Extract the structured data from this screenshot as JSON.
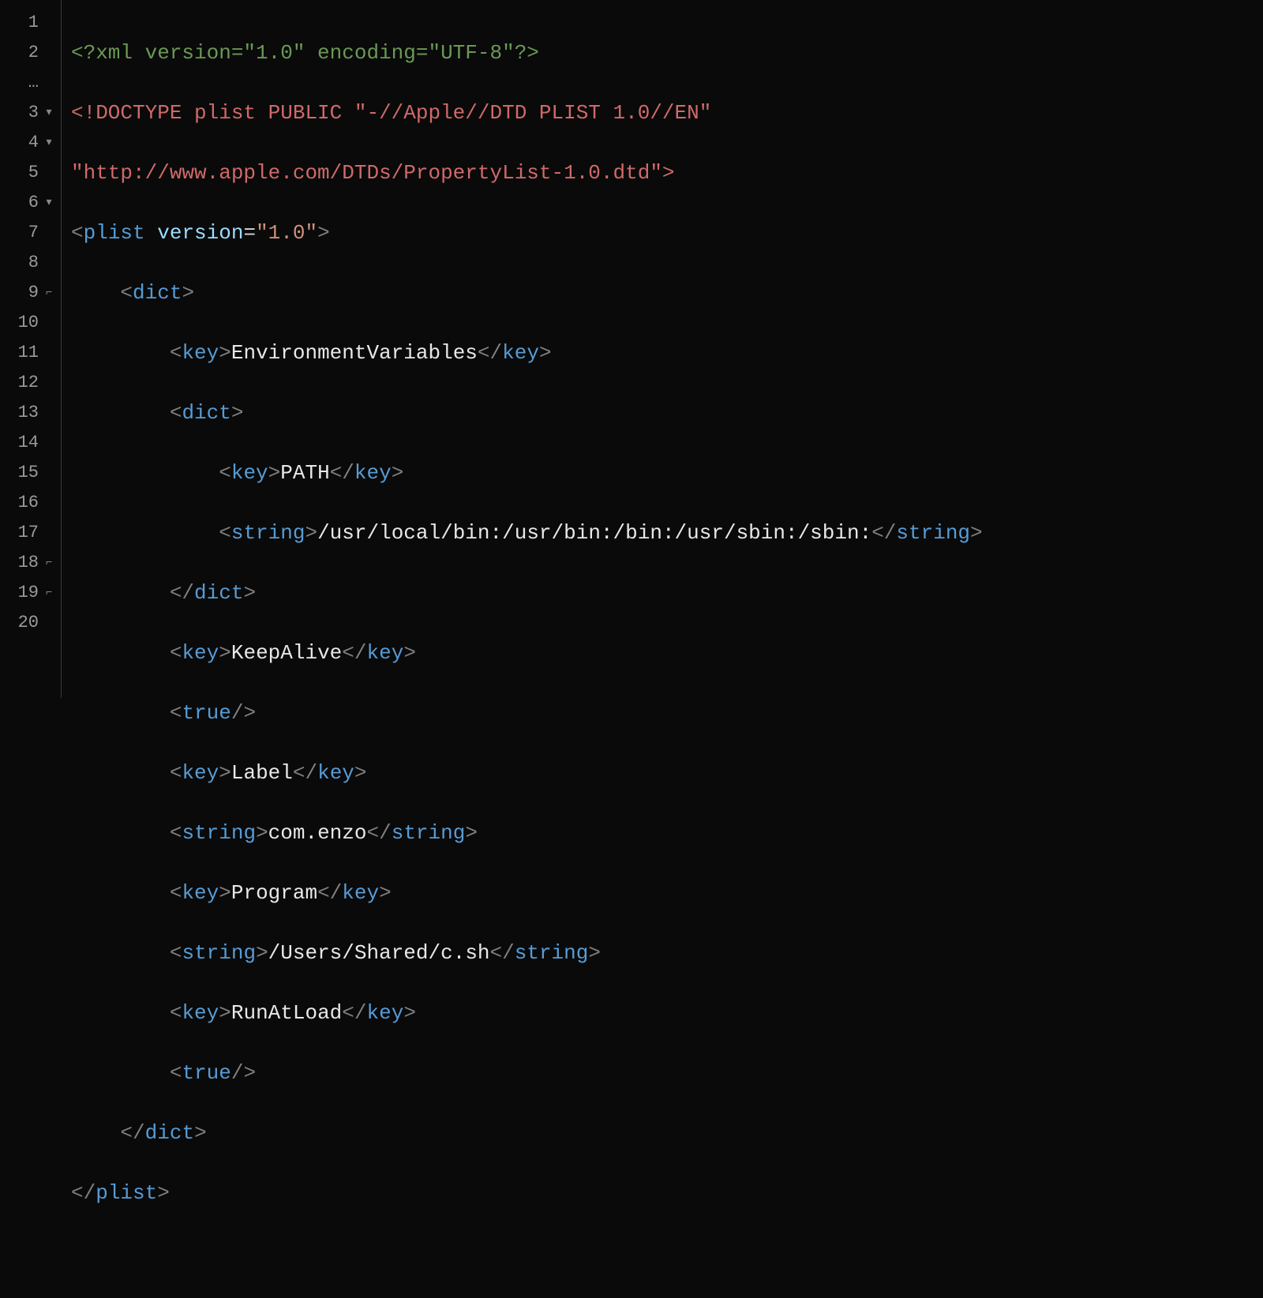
{
  "gutter": [
    {
      "n": "1",
      "fold": ""
    },
    {
      "n": "2",
      "fold": ""
    },
    {
      "n": "…",
      "fold": ""
    },
    {
      "n": "3",
      "fold": "▾"
    },
    {
      "n": "4",
      "fold": "▾"
    },
    {
      "n": "5",
      "fold": ""
    },
    {
      "n": "6",
      "fold": "▾"
    },
    {
      "n": "7",
      "fold": ""
    },
    {
      "n": "8",
      "fold": ""
    },
    {
      "n": "9",
      "fold": "⌐"
    },
    {
      "n": "10",
      "fold": ""
    },
    {
      "n": "11",
      "fold": ""
    },
    {
      "n": "12",
      "fold": ""
    },
    {
      "n": "13",
      "fold": ""
    },
    {
      "n": "14",
      "fold": ""
    },
    {
      "n": "15",
      "fold": ""
    },
    {
      "n": "16",
      "fold": ""
    },
    {
      "n": "17",
      "fold": ""
    },
    {
      "n": "18",
      "fold": "⌐"
    },
    {
      "n": "19",
      "fold": "⌐"
    },
    {
      "n": "20",
      "fold": ""
    }
  ],
  "code": {
    "l1": {
      "decl": "<?xml version=\"1.0\" encoding=\"UTF-8\"?>"
    },
    "l2": {
      "a": "<!DOCTYPE plist PUBLIC \"-//Apple//DTD PLIST 1.0//EN\""
    },
    "l2b": {
      "a": "\"http://www.apple.com/DTDs/PropertyList-1.0.dtd\">"
    },
    "l3": {
      "tag": "plist",
      "attr": "version",
      "val": "\"1.0\""
    },
    "l4": {
      "tag": "dict"
    },
    "l5": {
      "tag": "key",
      "text": "EnvironmentVariables"
    },
    "l6": {
      "tag": "dict"
    },
    "l7": {
      "tag": "key",
      "text": "PATH"
    },
    "l8": {
      "tag": "string",
      "text": "/usr/local/bin:/usr/bin:/bin:/usr/sbin:/sbin:"
    },
    "l9": {
      "tag": "dict"
    },
    "l10": {
      "tag": "key",
      "text": "KeepAlive"
    },
    "l11": {
      "tag": "true"
    },
    "l12": {
      "tag": "key",
      "text": "Label"
    },
    "l13": {
      "tag": "string",
      "text": "com.enzo"
    },
    "l14": {
      "tag": "key",
      "text": "Program"
    },
    "l15": {
      "tag": "string",
      "text": "/Users/Shared/c.sh"
    },
    "l16": {
      "tag": "key",
      "text": "RunAtLoad"
    },
    "l17": {
      "tag": "true"
    },
    "l18": {
      "tag": "dict"
    },
    "l19": {
      "tag": "plist"
    }
  }
}
